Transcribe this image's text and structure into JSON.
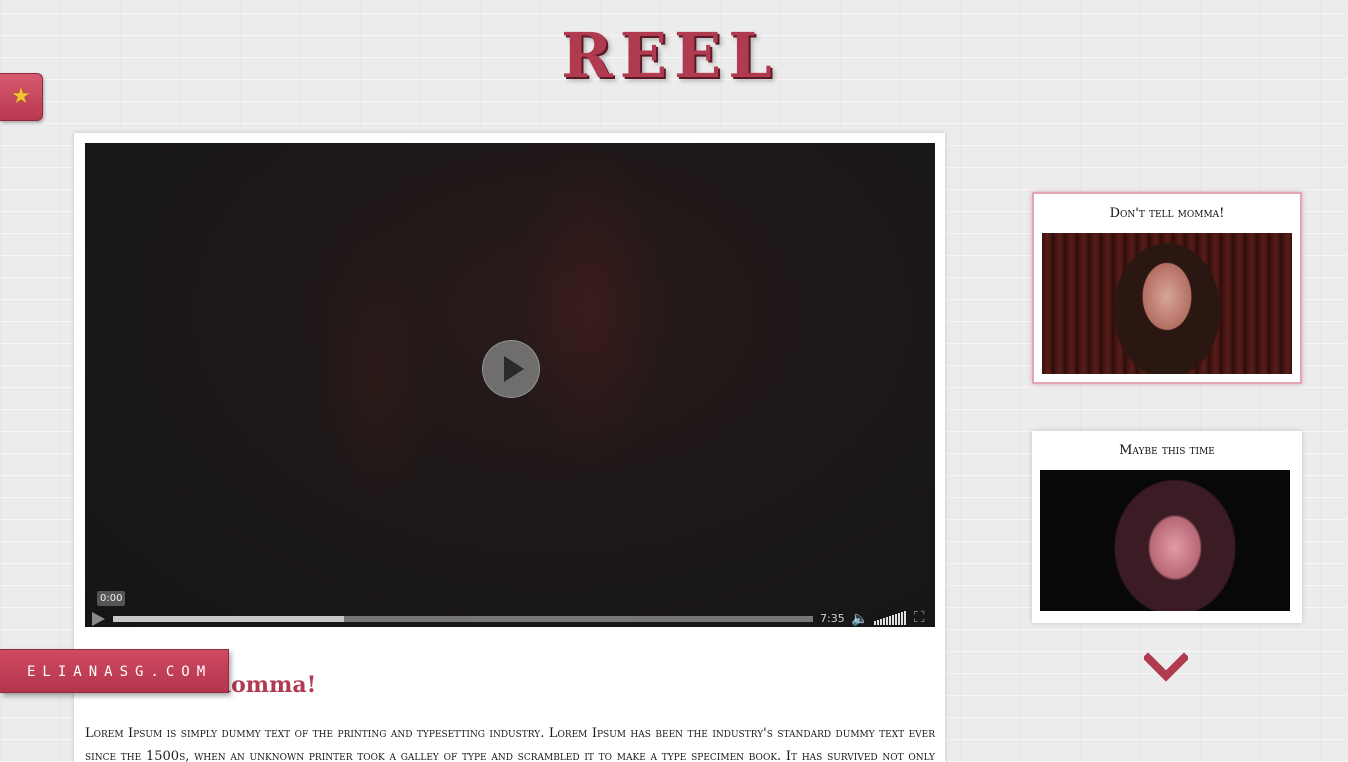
{
  "header": {
    "title": "REEL"
  },
  "favorite_tab": {
    "icon": "star-icon"
  },
  "brand_tab": {
    "label": "ELIANASG.COM"
  },
  "video_player": {
    "current_time": "0:00",
    "duration": "7:35",
    "buffered_fraction": 0.33,
    "volume_level": 1.0
  },
  "main": {
    "video_title": "Don't tell momma!",
    "description": "Lorem Ipsum is simply dummy text of the printing and typesetting industry. Lorem Ipsum has been the industry's standard dummy text ever since the 1500s, when an unknown printer took a galley of type and scrambled it to make a type specimen book. It has survived not only five centuries,"
  },
  "playlist": [
    {
      "title": "Don't tell momma!",
      "active": true
    },
    {
      "title": "Maybe this time",
      "active": false
    }
  ],
  "colors": {
    "accent": "#b03a50",
    "accent_light": "#e3a5b2"
  }
}
